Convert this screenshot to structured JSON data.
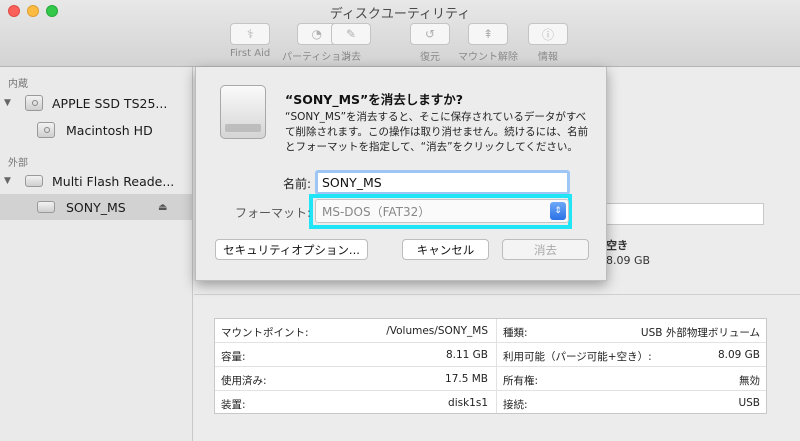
{
  "window": {
    "title": "ディスクユーティリティ"
  },
  "toolbar": [
    {
      "label": "First Aid",
      "icon": "stethoscope-icon"
    },
    {
      "label": "パーティション",
      "icon": "partition-icon"
    },
    {
      "label": "消去",
      "icon": "erase-icon"
    },
    {
      "label": "復元",
      "icon": "restore-icon"
    },
    {
      "label": "マウント解除",
      "icon": "unmount-icon"
    },
    {
      "label": "情報",
      "icon": "info-icon"
    }
  ],
  "sidebar": {
    "internal_label": "内蔵",
    "external_label": "外部",
    "items": [
      {
        "name": "APPLE SSD TS25..."
      },
      {
        "name": "Macintosh HD"
      },
      {
        "name": "Multi Flash Reade..."
      },
      {
        "name": "SONY_MS"
      }
    ]
  },
  "dialog": {
    "title": "“SONY_MS”を消去しますか?",
    "message": "“SONY_MS”を消去すると、そこに保存されているデータがすべて削除されます。この操作は取り消せません。続けるには、名前とフォーマットを指定して、“消去”をクリックしてください。",
    "name_label": "名前:",
    "name_value": "SONY_MS",
    "format_label": "フォーマット:",
    "format_value": "MS-DOS（FAT32）",
    "security_button": "セキュリティオプション...",
    "cancel_button": "キャンセル",
    "erase_button": "消去"
  },
  "background": {
    "free_label_fragment": "空き",
    "free_value_fragment": "8.09 GB"
  },
  "info_table": [
    {
      "left_key": "マウントポイント:",
      "left_value": "/Volumes/SONY_MS",
      "right_key": "種類:",
      "right_value": "USB 外部物理ボリューム"
    },
    {
      "left_key": "容量:",
      "left_value": "8.11 GB",
      "right_key": "利用可能（パージ可能+空き）:",
      "right_value": "8.09 GB"
    },
    {
      "left_key": "使用済み:",
      "left_value": "17.5 MB",
      "right_key": "所有権:",
      "right_value": "無効"
    },
    {
      "left_key": "装置:",
      "left_value": "disk1s1",
      "right_key": "接続:",
      "right_value": "USB"
    }
  ],
  "colors": {
    "focus_ring": "#1fe5f7",
    "select_arrow": "#2a71e6"
  }
}
